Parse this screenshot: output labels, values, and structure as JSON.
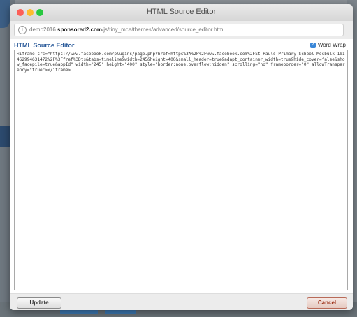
{
  "window": {
    "title": "HTML Source Editor"
  },
  "address": {
    "prefix": "demo2016.",
    "domain": "sponsored2.com",
    "path": "/js/tiny_mce/themes/advanced/source_editor.htm"
  },
  "editor": {
    "title": "HTML Source Editor",
    "word_wrap_label": "Word Wrap",
    "word_wrap_checked": true,
    "source": "<iframe src=\"https://www.facebook.com/plugins/page.php?href=https%3A%2F%2Fwww.facebook.com%2FSt-Pauls-Primary-School-Mosbulk-101462994631472%2F%3Ffref%3Dts&tabs=timeline&width=245&height=400&small_header=true&adapt_container_width=true&hide_cover=false&show_facepile=true&appId\" width=\"245\" height=\"400\" style=\"border:none;overflow:hidden\" scrolling=\"no\" frameborder=\"0\" allowTransparency=\"true\"></iframe>"
  },
  "buttons": {
    "update": "Update",
    "cancel": "Cancel"
  },
  "colors": {
    "accent": "#2b5b9a",
    "cancel": "#a13a22"
  }
}
